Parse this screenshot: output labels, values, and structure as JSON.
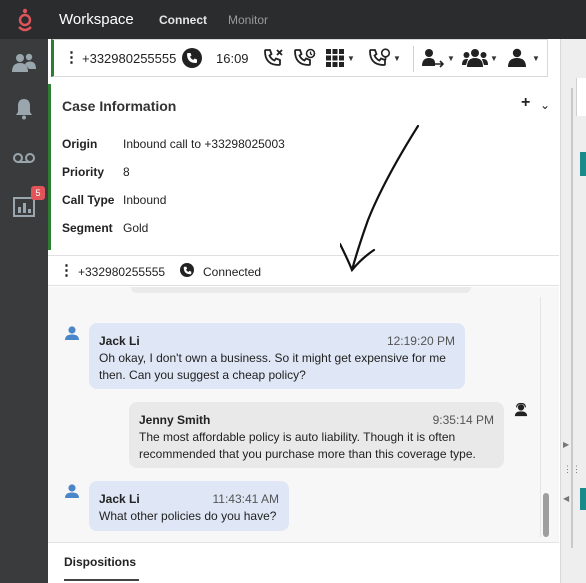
{
  "topbar": {
    "title": "Workspace",
    "tabs": [
      {
        "label": "Connect",
        "active": true
      },
      {
        "label": "Monitor",
        "active": false
      }
    ],
    "accent_color": "#e0545a"
  },
  "sidebar": {
    "items": [
      {
        "icon": "contacts-icon"
      },
      {
        "icon": "bell-icon"
      },
      {
        "icon": "voicemail-icon"
      },
      {
        "icon": "reports-icon",
        "badge": "5"
      }
    ]
  },
  "toolbar": {
    "phone_number": "+332980255555",
    "timer": "16:09",
    "buttons": [
      "end-call-icon",
      "hold-call-icon",
      "keypad-icon",
      "consult-icon",
      "transfer-icon",
      "conference-icon",
      "instant-transfer-icon"
    ]
  },
  "case_info": {
    "title": "Case Information",
    "fields": [
      {
        "label": "Origin",
        "value": "Inbound call to +33298025003"
      },
      {
        "label": "Priority",
        "value": "8"
      },
      {
        "label": "Call Type",
        "value": "Inbound"
      },
      {
        "label": "Segment",
        "value": "Gold"
      }
    ]
  },
  "interaction": {
    "phone_number": "+332980255555",
    "status": "Connected"
  },
  "transcript": {
    "messages": [
      {
        "sender": "Jack Li",
        "time": "12:19:20 PM",
        "text": "Oh okay, I don't own a business. So it might get expensive for me then. Can you suggest a cheap policy?",
        "role": "customer"
      },
      {
        "sender": "Jenny Smith",
        "time": "9:35:14 PM",
        "text": "The most affordable policy is auto liability. Though it is often recommended that you purchase more than this coverage type.",
        "role": "agent"
      },
      {
        "sender": "Jack Li",
        "time": "11:43:41 AM",
        "text": "What other policies do you have?",
        "role": "customer"
      }
    ]
  },
  "dispositions": {
    "tab_label": "Dispositions"
  },
  "colors": {
    "status_green": "#2e7d32",
    "customer_bubble": "#dfe6f5",
    "agent_bubble": "#e9e9e9",
    "dark_bar": "#2b2c2e"
  }
}
